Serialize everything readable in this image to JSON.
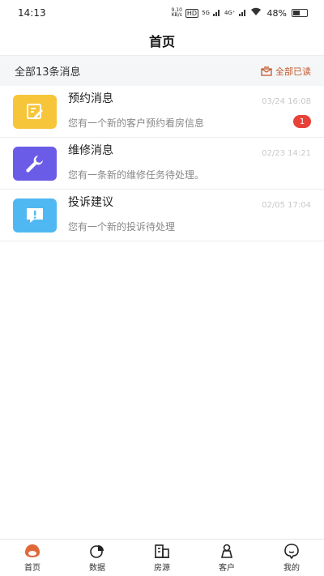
{
  "status_bar": {
    "time": "14:13",
    "speed_value": "9.10",
    "speed_unit": "KB/s",
    "net1": "5G",
    "net2": "4G⁺",
    "battery_percent": "48%",
    "battery_level": 0.48
  },
  "header": {
    "title": "首页"
  },
  "summary": {
    "count_label": "全部13条消息",
    "read_all_label": "全部已读"
  },
  "colors": {
    "accent": "#c2572a",
    "badge": "#e8413a",
    "appointment_icon_bg": "#f7c53a",
    "repair_icon_bg": "#6b5ce7",
    "complaint_icon_bg": "#4fb8f2"
  },
  "messages": [
    {
      "title": "预约消息",
      "desc": "您有一个新的客户预约看房信息",
      "time": "03/24 16:08",
      "badge": "1",
      "icon": "edit-note-icon"
    },
    {
      "title": "维修消息",
      "desc": "您有一条新的维修任务待处理。",
      "time": "02/23 14:21",
      "badge": "",
      "icon": "wrench-icon"
    },
    {
      "title": "投诉建议",
      "desc": "您有一个新的投诉待处理",
      "time": "02/05 17:04",
      "badge": "",
      "icon": "alert-message-icon"
    }
  ],
  "tabs": [
    {
      "label": "首页",
      "icon": "home-icon",
      "active": true
    },
    {
      "label": "数据",
      "icon": "pie-chart-icon",
      "active": false
    },
    {
      "label": "房源",
      "icon": "building-icon",
      "active": false
    },
    {
      "label": "客户",
      "icon": "customer-icon",
      "active": false
    },
    {
      "label": "我的",
      "icon": "profile-icon",
      "active": false
    }
  ]
}
